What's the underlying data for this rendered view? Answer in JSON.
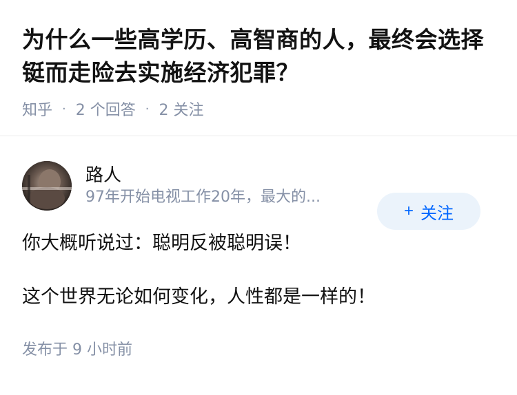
{
  "question": {
    "title": "为什么一些高学历、高智商的人，最终会选择铤而走险去实施经济犯罪？",
    "source": "知乎",
    "answer_count": "2 个回答",
    "follow_count": "2 关注"
  },
  "answer": {
    "author_name": "路人",
    "author_bio": "97年开始电视工作20年，最大的...",
    "follow_button": {
      "icon": "+",
      "label": "关注"
    },
    "paragraphs": [
      "你大概听说过：聪明反被聪明误！",
      "这个世界无论如何变化，人性都是一样的！"
    ],
    "published": "发布于  9 小时前"
  },
  "colors": {
    "accent": "#0066ff",
    "follow_bg": "#ebf3fb",
    "meta_text": "#8590a6",
    "divider": "#ebebeb"
  },
  "icons": {
    "separator": "·"
  }
}
